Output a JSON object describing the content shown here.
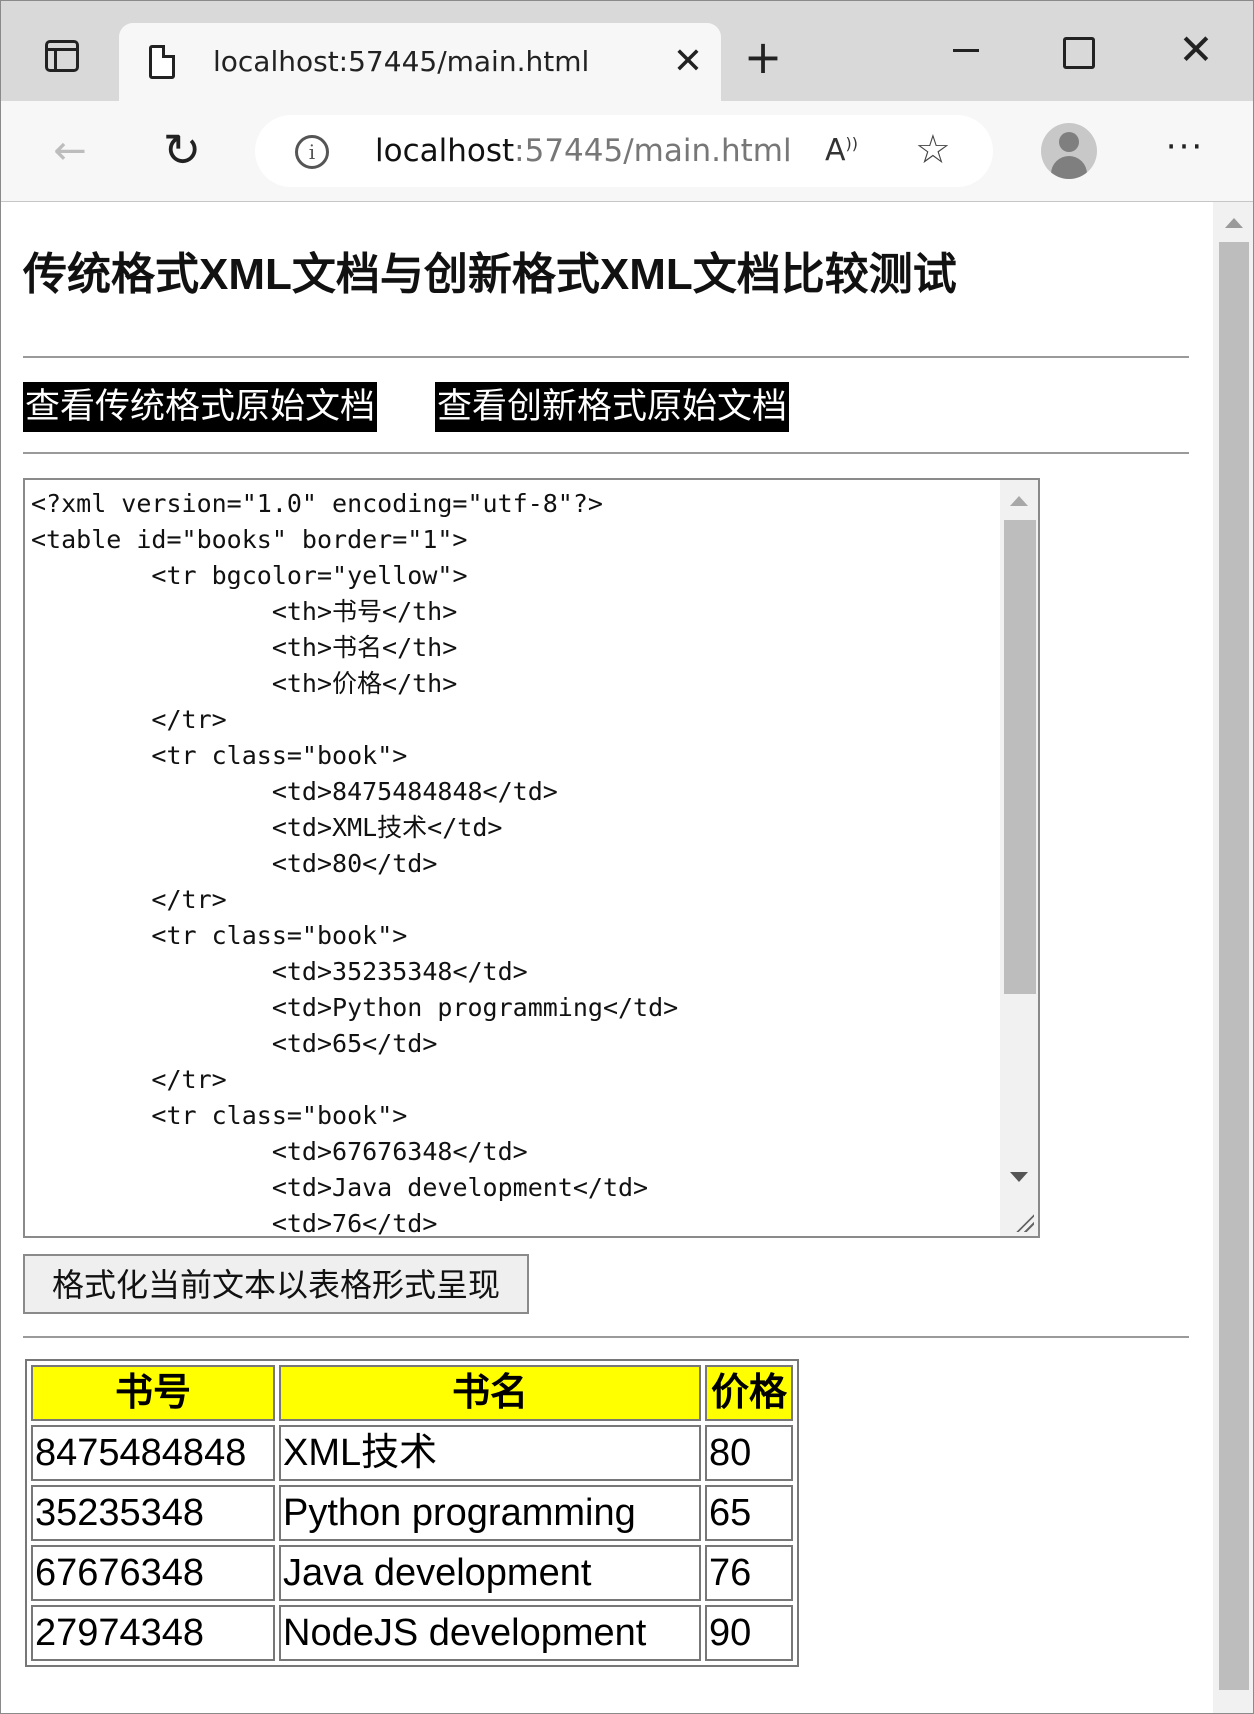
{
  "browser": {
    "tab_title": "localhost:57445/main.html",
    "close_glyph": "✕",
    "new_tab_glyph": "+",
    "url_host": "localhost",
    "url_rest": ":57445/main.html"
  },
  "page": {
    "heading": "传统格式XML文档与创新格式XML文档比较测试",
    "buttons": {
      "view_traditional": "查看传统格式原始文档",
      "view_innovative": "查看创新格式原始文档",
      "format": "格式化当前文本以表格形式呈现"
    },
    "xml_source": "<?xml version=\"1.0\" encoding=\"utf-8\"?>\n<table id=\"books\" border=\"1\">\n\t<tr bgcolor=\"yellow\">\n\t\t<th>书号</th>\n\t\t<th>书名</th>\n\t\t<th>价格</th>\n\t</tr>\n\t<tr class=\"book\">\n\t\t<td>8475484848</td>\n\t\t<td>XML技术</td>\n\t\t<td>80</td>\n\t</tr>\n\t<tr class=\"book\">\n\t\t<td>35235348</td>\n\t\t<td>Python programming</td>\n\t\t<td>65</td>\n\t</tr>\n\t<tr class=\"book\">\n\t\t<td>67676348</td>\n\t\t<td>Java development</td>\n\t\t<td>76</td>",
    "table": {
      "headers": [
        "书号",
        "书名",
        "价格"
      ],
      "header_bg": "#ffff00",
      "rows": [
        [
          "8475484848",
          "XML技术",
          "80"
        ],
        [
          "35235348",
          "Python programming",
          "65"
        ],
        [
          "67676348",
          "Java development",
          "76"
        ],
        [
          "27974348",
          "NodeJS development",
          "90"
        ]
      ]
    }
  }
}
